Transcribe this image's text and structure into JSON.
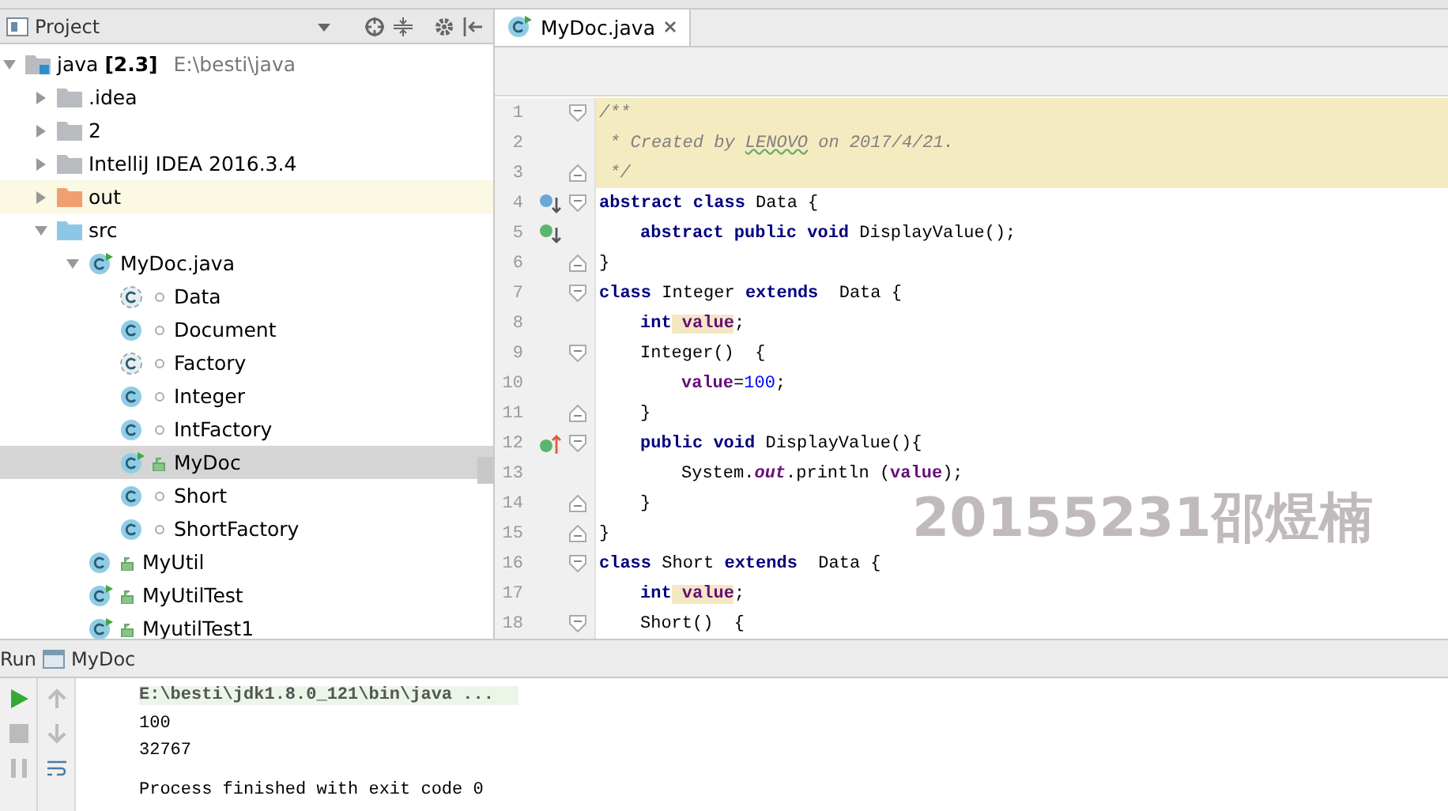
{
  "project_panel": {
    "title": "Project",
    "tree": [
      {
        "kind": "module",
        "label": "java",
        "badge": "[2.3]",
        "path": "E:\\besti\\java",
        "expanded": true,
        "children": [
          {
            "kind": "folder",
            "label": ".idea",
            "expanded": false
          },
          {
            "kind": "folder",
            "label": "2",
            "expanded": false
          },
          {
            "kind": "folder",
            "label": "IntelliJ IDEA 2016.3.4",
            "expanded": false
          },
          {
            "kind": "excluded",
            "label": "out",
            "expanded": false
          },
          {
            "kind": "source",
            "label": "src",
            "expanded": true,
            "children": [
              {
                "kind": "runnable-file",
                "label": "MyDoc.java",
                "expanded": true,
                "children": [
                  {
                    "kind": "abstract",
                    "public": false,
                    "label": "Data",
                    "selected": false
                  },
                  {
                    "kind": "class",
                    "public": false,
                    "label": "Document",
                    "selected": false
                  },
                  {
                    "kind": "abstract",
                    "public": false,
                    "label": "Factory",
                    "selected": false
                  },
                  {
                    "kind": "class",
                    "public": false,
                    "label": "Integer",
                    "selected": false
                  },
                  {
                    "kind": "class",
                    "public": false,
                    "label": "IntFactory",
                    "selected": false
                  },
                  {
                    "kind": "runnable",
                    "public": true,
                    "label": "MyDoc",
                    "selected": true
                  },
                  {
                    "kind": "class",
                    "public": false,
                    "label": "Short",
                    "selected": false
                  },
                  {
                    "kind": "class",
                    "public": false,
                    "label": "ShortFactory",
                    "selected": false
                  }
                ]
              },
              {
                "kind": "class",
                "public": true,
                "label": "MyUtil",
                "selected": false
              },
              {
                "kind": "runnable",
                "public": true,
                "label": "MyUtilTest",
                "selected": false
              },
              {
                "kind": "runnable",
                "public": true,
                "label": "MyutilTest1",
                "selected": false
              }
            ]
          }
        ]
      }
    ]
  },
  "editor": {
    "tabs": [
      {
        "label": "MyDoc.java",
        "selected": true
      }
    ],
    "lines": [
      {
        "number": "1",
        "fold": {
          "kind": "open"
        },
        "highlighted": true,
        "tokens": [
          {
            "kind": "comment",
            "text": "/**"
          }
        ]
      },
      {
        "number": "2",
        "highlighted": true,
        "tokens": [
          {
            "kind": "comment",
            "text": " * Created by "
          },
          {
            "kind": "typo",
            "text": "LENOVO"
          },
          {
            "kind": "comment",
            "text": " on 2017/4/21."
          }
        ]
      },
      {
        "number": "3",
        "fold": {
          "kind": "close"
        },
        "highlighted": true,
        "tokens": [
          {
            "kind": "comment",
            "text": " */"
          }
        ]
      },
      {
        "number": "4",
        "fold": {
          "kind": "open"
        },
        "highlighted": false,
        "marker": {
          "kind": "overridden"
        },
        "tokens": [
          {
            "kind": "keyword",
            "text": "abstract class"
          },
          {
            "kind": "plain",
            "text": " Data {"
          }
        ]
      },
      {
        "number": "5",
        "highlighted": false,
        "indent": {
          "kind": "single"
        },
        "marker": {
          "kind": "implemented"
        },
        "tokens": [
          {
            "kind": "keyword",
            "text": "abstract public void"
          },
          {
            "kind": "plain",
            "text": " DisplayValue();"
          }
        ]
      },
      {
        "number": "6",
        "fold": {
          "kind": "close"
        },
        "highlighted": false,
        "tokens": [
          {
            "kind": "plain",
            "text": "}"
          }
        ]
      },
      {
        "number": "7",
        "fold": {
          "kind": "open"
        },
        "highlighted": false,
        "tokens": [
          {
            "kind": "keyword",
            "text": "class"
          },
          {
            "kind": "plain",
            "text": " Integer "
          },
          {
            "kind": "keyword",
            "text": "extends"
          },
          {
            "kind": "plain",
            "text": "  Data {"
          }
        ]
      },
      {
        "number": "8",
        "highlighted": false,
        "indent": {
          "kind": "single"
        },
        "tokens": [
          {
            "kind": "keyword",
            "text": "int"
          },
          {
            "kind": "usage",
            "text": "value"
          },
          {
            "kind": "plain",
            "text": ";"
          }
        ]
      },
      {
        "number": "9",
        "fold": {
          "kind": "open"
        },
        "highlighted": false,
        "indent": {
          "kind": "single"
        },
        "tokens": [
          {
            "kind": "plain",
            "text": "Integer()  {"
          }
        ]
      },
      {
        "number": "10",
        "highlighted": false,
        "indent": {
          "kind": "double"
        },
        "tokens": [
          {
            "kind": "field",
            "text": "value"
          },
          {
            "kind": "plain",
            "text": "="
          },
          {
            "kind": "number",
            "text": "100"
          },
          {
            "kind": "plain",
            "text": ";"
          }
        ]
      },
      {
        "number": "11",
        "fold": {
          "kind": "close"
        },
        "highlighted": false,
        "indent": {
          "kind": "single"
        },
        "tokens": [
          {
            "kind": "plain",
            "text": "}"
          }
        ]
      },
      {
        "number": "12",
        "fold": {
          "kind": "open"
        },
        "highlighted": false,
        "indent": {
          "kind": "single"
        },
        "marker": {
          "kind": "implementing"
        },
        "tokens": [
          {
            "kind": "keyword",
            "text": "public void"
          },
          {
            "kind": "plain",
            "text": " DisplayValue(){"
          }
        ]
      },
      {
        "number": "13",
        "highlighted": false,
        "indent": {
          "kind": "double"
        },
        "tokens": [
          {
            "kind": "plain",
            "text": "System."
          },
          {
            "kind": "static",
            "text": "out"
          },
          {
            "kind": "plain",
            "text": ".println ("
          },
          {
            "kind": "field",
            "text": "value"
          },
          {
            "kind": "plain",
            "text": ");"
          }
        ]
      },
      {
        "number": "14",
        "fold": {
          "kind": "close"
        },
        "highlighted": false,
        "indent": {
          "kind": "single"
        },
        "tokens": [
          {
            "kind": "plain",
            "text": "}"
          }
        ]
      },
      {
        "number": "15",
        "fold": {
          "kind": "close"
        },
        "highlighted": false,
        "tokens": [
          {
            "kind": "plain",
            "text": "}"
          }
        ]
      },
      {
        "number": "16",
        "fold": {
          "kind": "open"
        },
        "highlighted": false,
        "tokens": [
          {
            "kind": "keyword",
            "text": "class"
          },
          {
            "kind": "plain",
            "text": " Short "
          },
          {
            "kind": "keyword",
            "text": "extends"
          },
          {
            "kind": "plain",
            "text": "  Data {"
          }
        ]
      },
      {
        "number": "17",
        "highlighted": false,
        "indent": {
          "kind": "single"
        },
        "tokens": [
          {
            "kind": "keyword",
            "text": "int"
          },
          {
            "kind": "usage",
            "text": "value"
          },
          {
            "kind": "plain",
            "text": ";"
          }
        ]
      },
      {
        "number": "18",
        "fold": {
          "kind": "open"
        },
        "highlighted": false,
        "indent": {
          "kind": "single"
        },
        "tokens": [
          {
            "kind": "plain",
            "text": "Short()  {"
          }
        ]
      }
    ],
    "overlay_text": "20155231邵煜楠"
  },
  "run_panel": {
    "title": "Run",
    "tab": "MyDoc",
    "console": [
      {
        "kind": "command",
        "text": "E:\\besti\\jdk1.8.0_121\\bin\\java ..."
      },
      {
        "kind": "output",
        "text": "100"
      },
      {
        "kind": "output",
        "text": "32767"
      },
      {
        "kind": "blank"
      },
      {
        "kind": "output",
        "text": "Process finished with exit code 0"
      }
    ]
  }
}
